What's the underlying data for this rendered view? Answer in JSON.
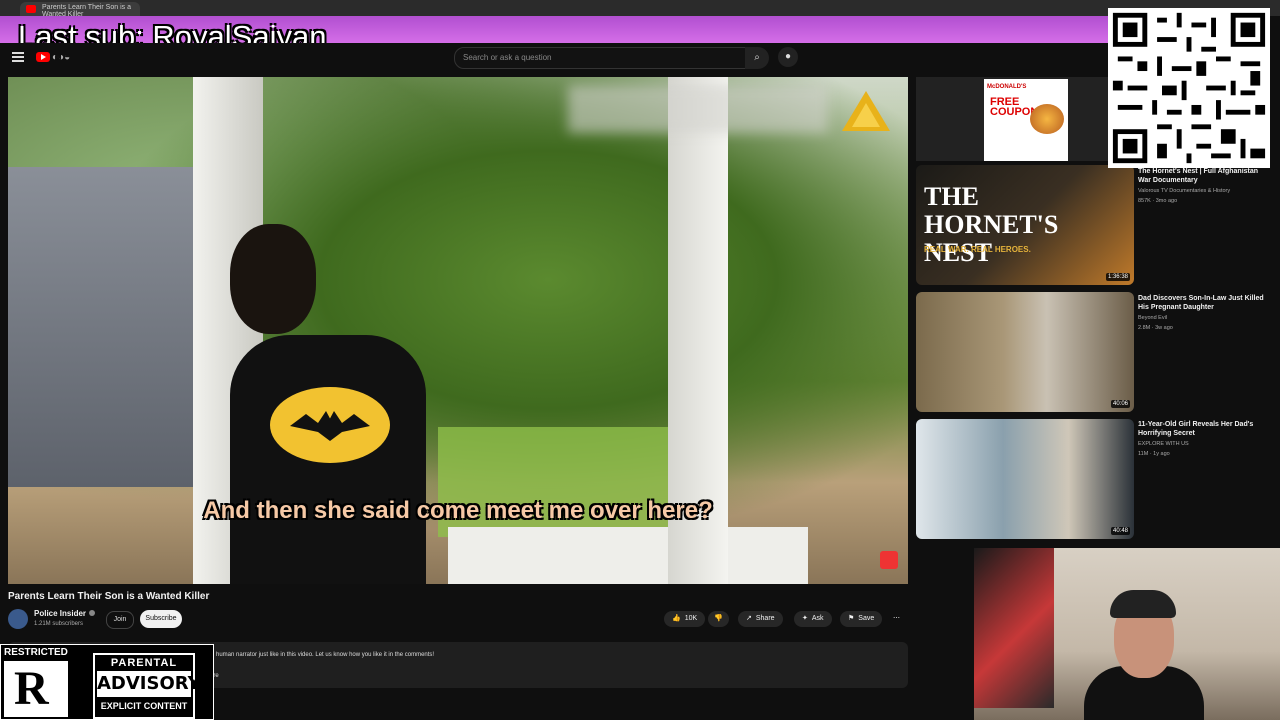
{
  "overlay": {
    "last_sub": "Last sub: RoyalSaiyan",
    "restricted_label": "RESTRICTED",
    "restricted_letter": "R",
    "advisory_top": "PARENTAL",
    "advisory_mid": "ADVISORY",
    "advisory_bottom": "EXPLICIT CONTENT"
  },
  "browser": {
    "tab_title": "Parents Learn Their Son is a Wanted Killer"
  },
  "header": {
    "search_placeholder": "Search or ask a question",
    "menu_icon": "menu-icon",
    "search_icon": "search-icon",
    "mic_icon": "mic-icon"
  },
  "video": {
    "caption": "And then she said come meet me over here?",
    "title": "Parents Learn Their Son is a Wanted Killer",
    "channel": "Police Insider",
    "subscribers": "1.21M subscribers",
    "join_label": "Join",
    "subscribe_label": "Subscribe",
    "likes": "10K",
    "share_label": "Share",
    "ask_label": "Ask",
    "save_label": "Save",
    "description": "human narrator just like in this video. Let us know how you like it in the comments!",
    "more_label": "ore"
  },
  "sidebar": {
    "ad_brand": "McDONALD'S",
    "ad_headline": "FREE COUPON",
    "items": [
      {
        "title": "The Hornet's Nest | Full Afghanistan War Documentary",
        "channel": "Valorous TV Documentaries & History",
        "meta": "857K · 3mo ago",
        "duration": "1:36:38",
        "thumb_title": "THE HORNET'S NEST",
        "thumb_sub": "REAL WAR. REAL HEROES."
      },
      {
        "title": "Dad Discovers Son-In-Law Just Killed His Pregnant Daughter",
        "channel": "Beyond Evil",
        "meta": "2.8M · 3w ago",
        "duration": "40:06"
      },
      {
        "title": "11-Year-Old Girl Reveals Her Dad's Horrifying Secret",
        "channel": "EXPLORE WITH US",
        "meta": "11M · 1y ago",
        "duration": "40:48"
      }
    ]
  },
  "colors": {
    "banner": "#c45ee0",
    "background": "#0f0f0f",
    "caption": "#f6c9a6",
    "accent_red": "#ff0000"
  }
}
